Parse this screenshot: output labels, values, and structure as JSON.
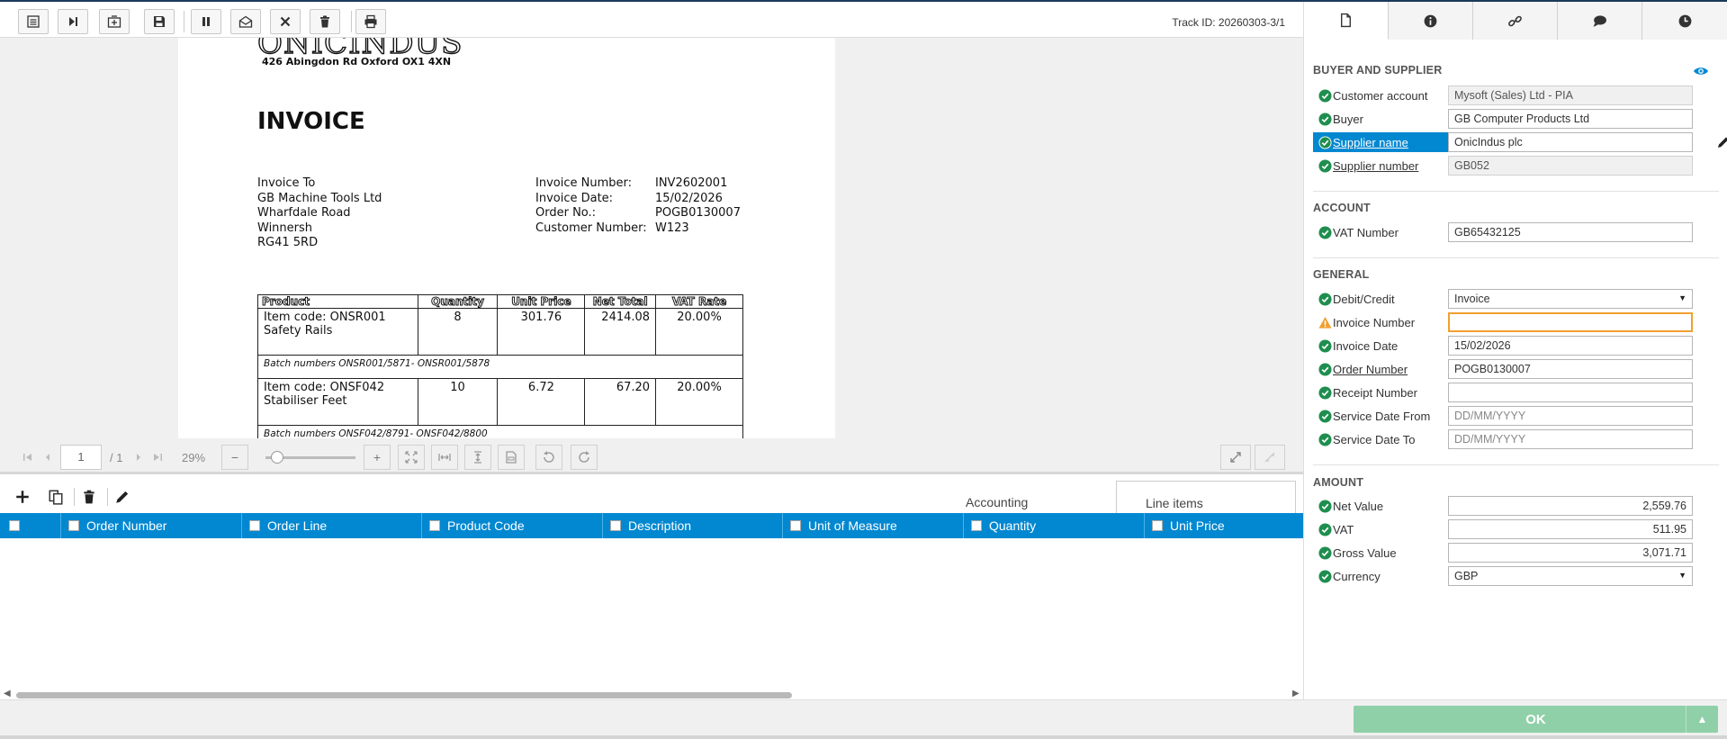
{
  "header": {
    "track_id": "Track ID: 20260303-3/1"
  },
  "document": {
    "logo_text": "ONICINDUS",
    "address": "426 Abingdon Rd Oxford OX1 4XN",
    "title": "INVOICE",
    "invoice_to": [
      "Invoice To",
      "GB Machine Tools Ltd",
      "Wharfdale Road",
      "Winnersh",
      "RG41 5RD"
    ],
    "meta": [
      {
        "k": "Invoice Number:",
        "v": "INV2602001"
      },
      {
        "k": "Invoice Date:",
        "v": "15/02/2026"
      },
      {
        "k": "Order No.:",
        "v": "POGB0130007"
      },
      {
        "k": "Customer Number:",
        "v": "W123"
      }
    ],
    "table_headers": [
      "Product",
      "Quantity",
      "Unit Price",
      "Net Total",
      "VAT Rate"
    ],
    "lines": [
      {
        "product1": "Item code: ONSR001",
        "product2": "Safety Rails",
        "qty": "8",
        "unit_price": "301.76",
        "net": "2414.08",
        "vat": "20.00%",
        "batch": "Batch numbers ONSR001/5871- ONSR001/5878"
      },
      {
        "product1": "Item code: ONSF042",
        "product2": "Stabiliser Feet",
        "qty": "10",
        "unit_price": "6.72",
        "net": "67.20",
        "vat": "20.00%",
        "batch": "Batch numbers ONSF042/8791- ONSF042/8800"
      }
    ]
  },
  "viewer": {
    "page": "1",
    "page_total": "/ 1",
    "zoom": "29%",
    "minus": "−",
    "plus": "+"
  },
  "grid": {
    "tab_accounting": "Accounting",
    "tab_line_items": "Line items",
    "columns": [
      "Order Number",
      "Order Line",
      "Product Code",
      "Description",
      "Unit of Measure",
      "Quantity",
      "Unit Price"
    ]
  },
  "panel": {
    "sections": {
      "buyer_supplier": "BUYER AND SUPPLIER",
      "account": "ACCOUNT",
      "general": "GENERAL",
      "amount": "AMOUNT"
    },
    "fields": {
      "customer_account": {
        "label": "Customer account",
        "value": "Mysoft (Sales) Ltd - PIA"
      },
      "buyer": {
        "label": "Buyer",
        "value": "GB Computer Products Ltd"
      },
      "supplier_name": {
        "label": "Supplier name",
        "value": "OnicIndus plc"
      },
      "supplier_number": {
        "label": "Supplier number",
        "value": "GB052"
      },
      "vat_number": {
        "label": "VAT Number",
        "value": "GB65432125"
      },
      "debit_credit": {
        "label": "Debit/Credit",
        "value": "Invoice"
      },
      "invoice_number": {
        "label": "Invoice Number",
        "value": ""
      },
      "invoice_date": {
        "label": "Invoice Date",
        "value": "15/02/2026"
      },
      "order_number": {
        "label": "Order Number",
        "value": "POGB0130007"
      },
      "receipt_number": {
        "label": "Receipt Number",
        "value": ""
      },
      "service_date_from": {
        "label": "Service Date From",
        "placeholder": "DD/MM/YYYY"
      },
      "service_date_to": {
        "label": "Service Date To",
        "placeholder": "DD/MM/YYYY"
      },
      "net_value": {
        "label": "Net Value",
        "value": "2,559.76"
      },
      "vat": {
        "label": "VAT",
        "value": "511.95"
      },
      "gross_value": {
        "label": "Gross Value",
        "value": "3,071.71"
      },
      "currency": {
        "label": "Currency",
        "value": "GBP"
      }
    }
  },
  "footer": {
    "ok_label": "OK"
  },
  "colors": {
    "accent": "#0288d1",
    "ok_green": "#8fd0a9",
    "check_green": "#1e8e4e",
    "warning": "#f0a030"
  }
}
